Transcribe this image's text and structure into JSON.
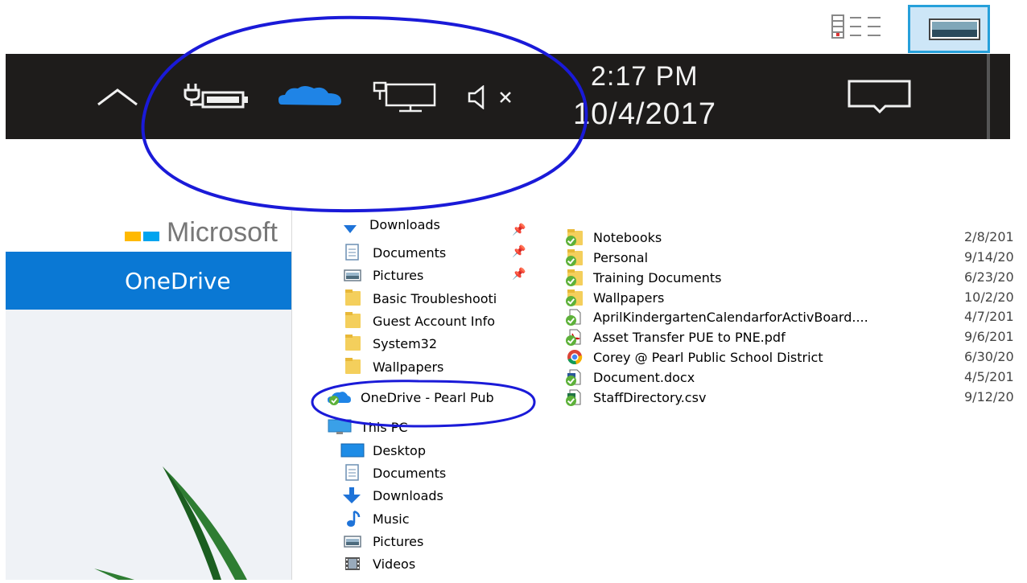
{
  "taskbar": {
    "time": "2:17 PM",
    "date": "10/4/2017",
    "icons": [
      "chevron-up-icon",
      "power-battery-icon",
      "onedrive-cloud-icon",
      "network-icon",
      "volume-muted-icon",
      "action-center-icon"
    ]
  },
  "view_toggle": {
    "icons": [
      "details-view-icon",
      "tiles-view-icon"
    ],
    "selected": "tiles"
  },
  "web_page": {
    "brand_text": "Microsoft",
    "banner_title": "OneDrive",
    "colors": {
      "banner": "#0a78d4",
      "logo_yellow": "#ffb900",
      "logo_blue": "#00a4ef"
    }
  },
  "explorer": {
    "nav": {
      "quick_access": [
        {
          "label": "Downloads",
          "icon": "download-icon",
          "pinned": true
        },
        {
          "label": "Documents",
          "icon": "documents-icon",
          "pinned": true
        },
        {
          "label": "Pictures",
          "icon": "pictures-icon",
          "pinned": true
        },
        {
          "label": "Basic Troubleshooti",
          "icon": "folder-icon"
        },
        {
          "label": "Guest Account Info",
          "icon": "folder-icon"
        },
        {
          "label": "System32",
          "icon": "folder-icon"
        },
        {
          "label": "Wallpapers",
          "icon": "folder-icon"
        }
      ],
      "onedrive": {
        "label": "OneDrive - Pearl Pub",
        "icon": "onedrive-icon"
      },
      "this_pc": {
        "label": "This PC",
        "icon": "computer-icon"
      },
      "this_pc_items": [
        {
          "label": "Desktop",
          "icon": "desktop-icon"
        },
        {
          "label": "Documents",
          "icon": "documents-icon"
        },
        {
          "label": "Downloads",
          "icon": "download-icon"
        },
        {
          "label": "Music",
          "icon": "music-icon"
        },
        {
          "label": "Pictures",
          "icon": "pictures-icon"
        },
        {
          "label": "Videos",
          "icon": "videos-icon"
        }
      ]
    },
    "files": [
      {
        "name": "Notebooks",
        "date": "2/8/201",
        "icon": "synced-folder-icon"
      },
      {
        "name": "Personal",
        "date": "9/14/20",
        "icon": "synced-folder-icon"
      },
      {
        "name": "Training Documents",
        "date": "6/23/20",
        "icon": "synced-folder-icon"
      },
      {
        "name": "Wallpapers",
        "date": "10/2/20",
        "icon": "synced-folder-icon"
      },
      {
        "name": "AprilKindergartenCalendarforActivBoard....",
        "date": "4/7/201",
        "icon": "synced-file-icon"
      },
      {
        "name": "Asset Transfer PUE to PNE.pdf",
        "date": "9/6/201",
        "icon": "synced-pdf-icon"
      },
      {
        "name": "Corey @ Pearl Public School District",
        "date": "6/30/20",
        "icon": "chrome-icon"
      },
      {
        "name": "Document.docx",
        "date": "4/5/201",
        "icon": "synced-word-icon"
      },
      {
        "name": "StaffDirectory.csv",
        "date": "9/12/20",
        "icon": "synced-csv-icon"
      }
    ]
  },
  "annotations": {
    "stroke_color": "#1a1ad8"
  }
}
